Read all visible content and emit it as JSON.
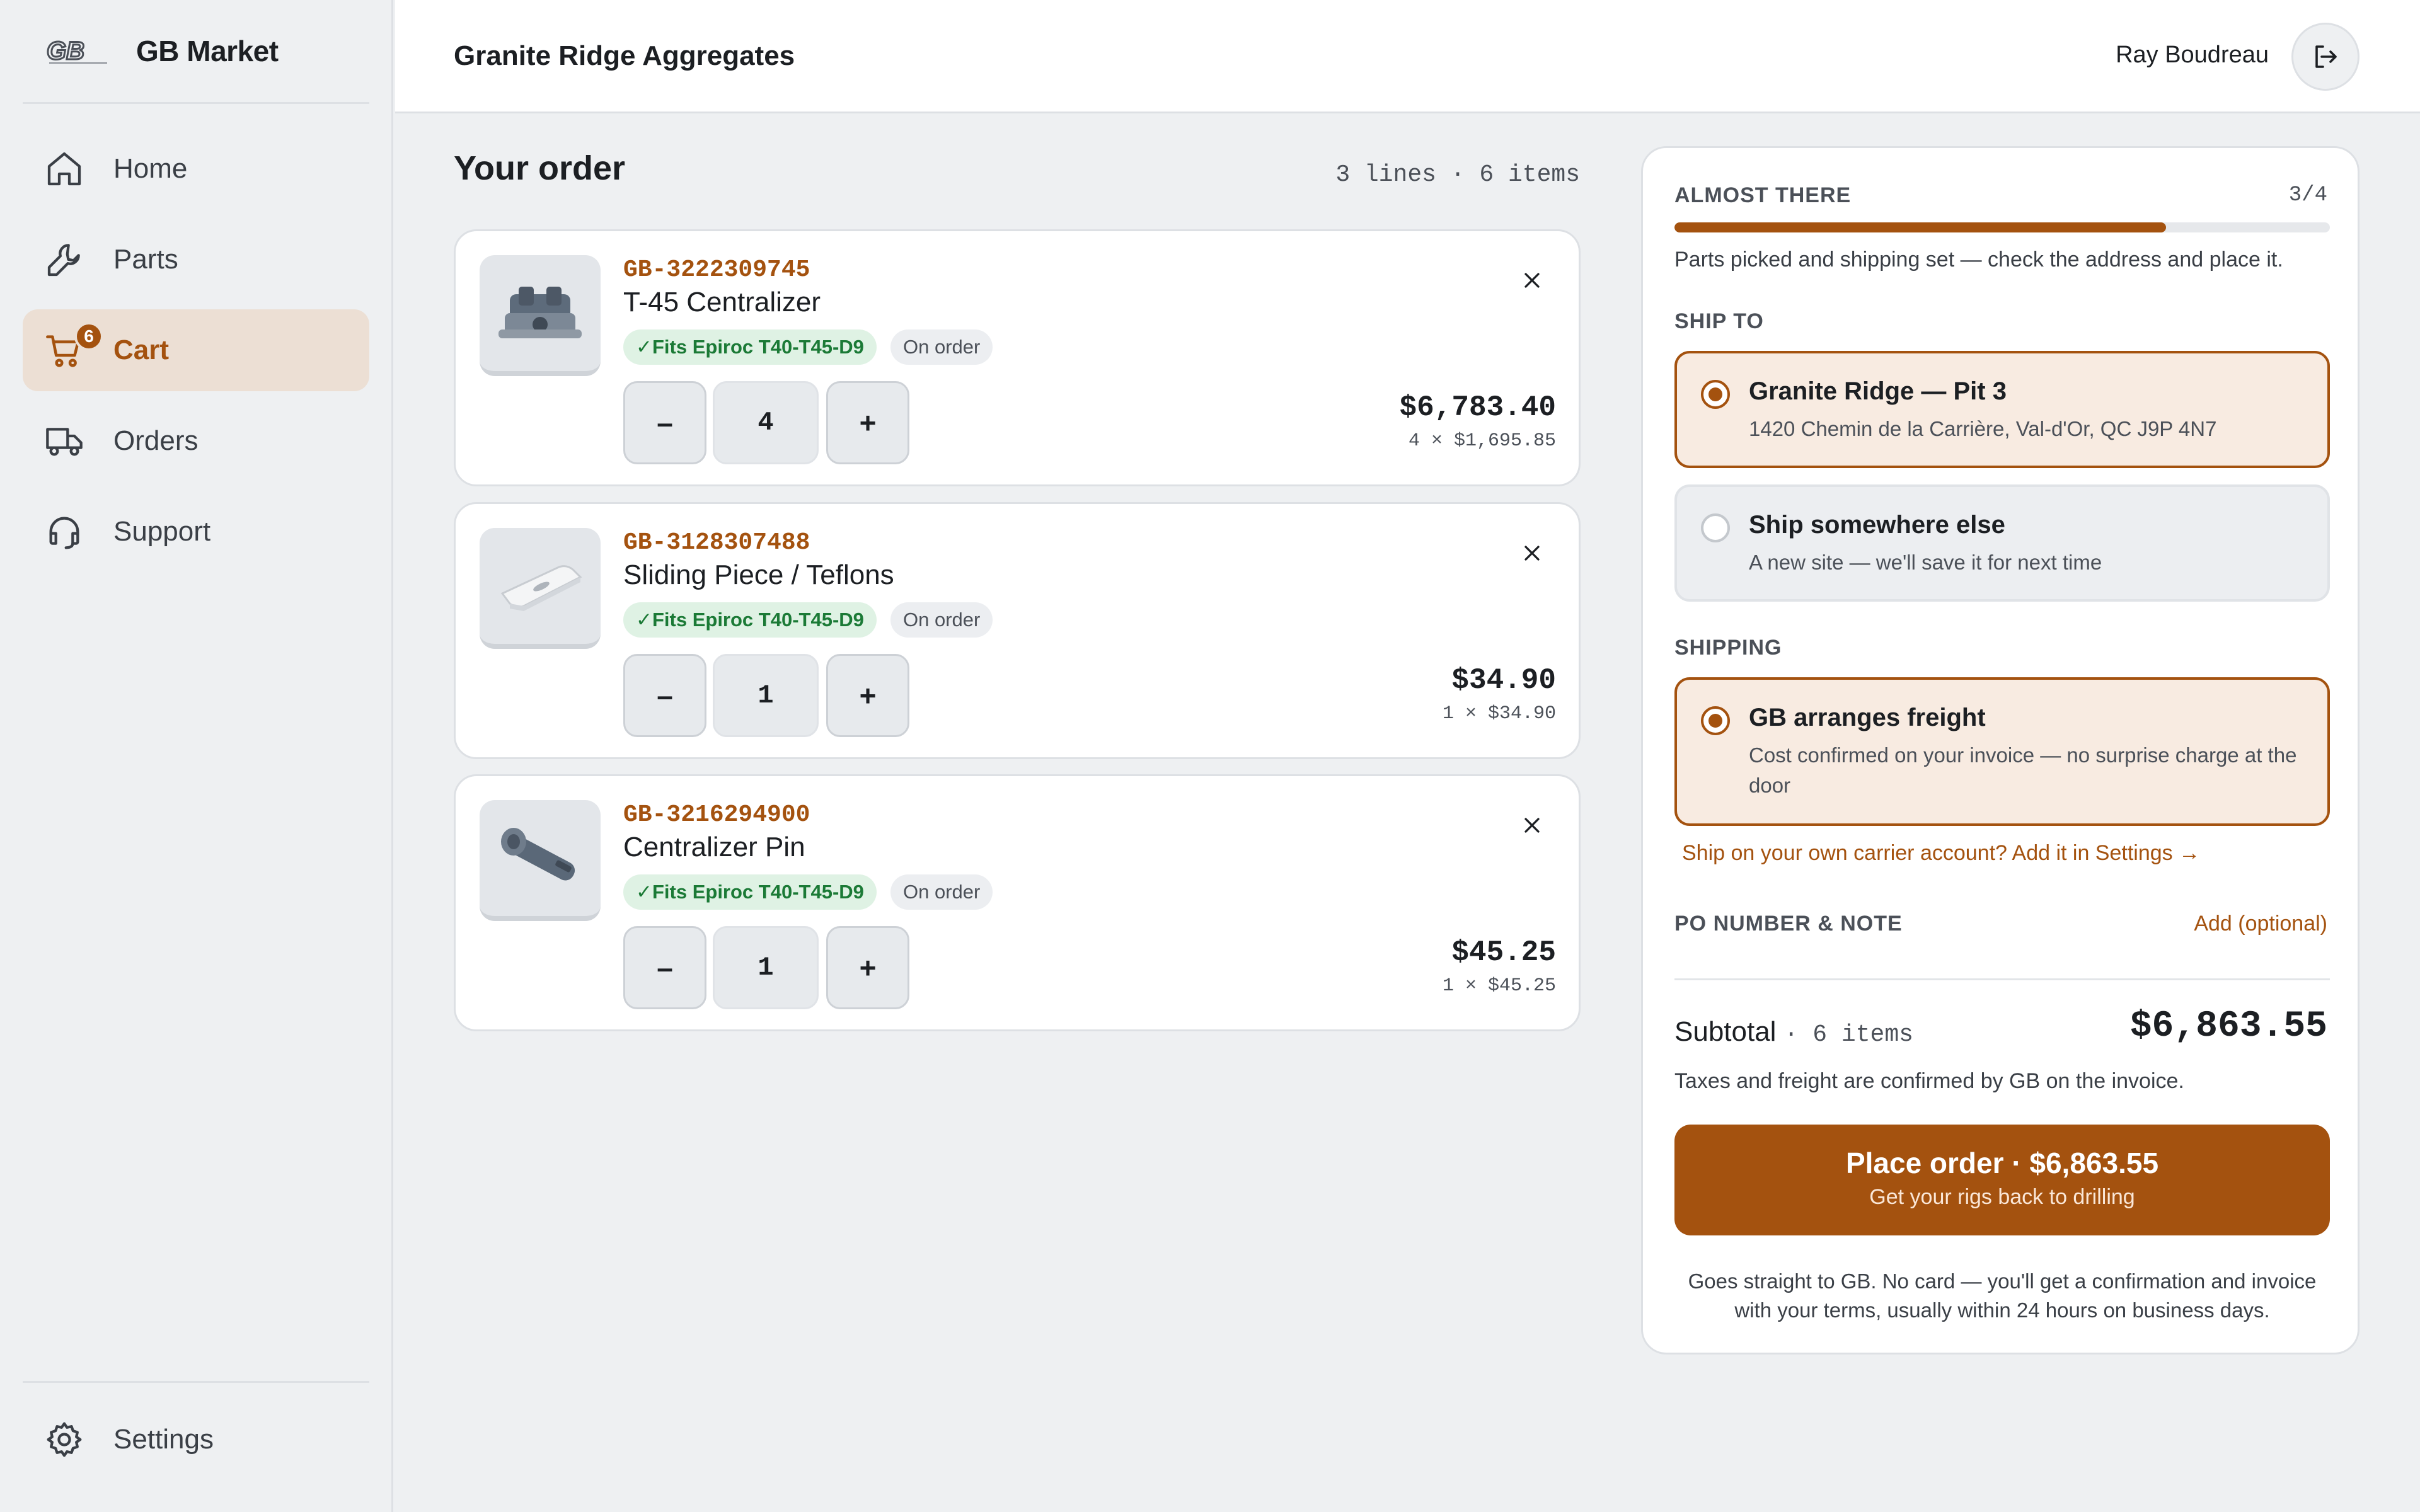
{
  "brand": {
    "name": "GB Market"
  },
  "sidebar": {
    "items": [
      {
        "label": "Home",
        "icon": "home-icon"
      },
      {
        "label": "Parts",
        "icon": "wrench-icon"
      },
      {
        "label": "Cart",
        "icon": "cart-icon",
        "badge": "6",
        "active": true
      },
      {
        "label": "Orders",
        "icon": "truck-icon"
      },
      {
        "label": "Support",
        "icon": "headset-icon"
      }
    ],
    "settings": {
      "label": "Settings",
      "icon": "gear-icon"
    }
  },
  "header": {
    "company": "Granite Ridge Aggregates",
    "user": "Ray Boudreau",
    "logout_icon": "logout-icon"
  },
  "order": {
    "title": "Your order",
    "summary": "3 lines · 6 items",
    "lines": [
      {
        "sku": "GB-3222309745",
        "name": "T-45 Centralizer",
        "fits": "✓Fits Epiroc T40-T45-D9",
        "status": "On order",
        "qty": "4",
        "total": "$6,783.40",
        "unit": "4 × $1,695.85"
      },
      {
        "sku": "GB-3128307488",
        "name": "Sliding Piece / Teflons",
        "fits": "✓Fits Epiroc T40-T45-D9",
        "status": "On order",
        "qty": "1",
        "total": "$34.90",
        "unit": "1 × $34.90"
      },
      {
        "sku": "GB-3216294900",
        "name": "Centralizer Pin",
        "fits": "✓Fits Epiroc T40-T45-D9",
        "status": "On order",
        "qty": "1",
        "total": "$45.25",
        "unit": "1 × $45.25"
      }
    ],
    "minus": "–",
    "plus": "+"
  },
  "checkout": {
    "progress_label": "ALMOST THERE",
    "progress_step": "3/4",
    "progress_fraction": 0.75,
    "progress_note": "Parts picked and shipping set — check the address and place it.",
    "ship_to_label": "SHIP TO",
    "ship_options": [
      {
        "title": "Granite Ridge — Pit 3",
        "sub": "1420 Chemin de la Carrière, Val-d'Or, QC J9P 4N7",
        "selected": true
      },
      {
        "title": "Ship somewhere else",
        "sub": "A new site — we'll save it for next time",
        "selected": false
      }
    ],
    "shipping_label": "SHIPPING",
    "shipping_option": {
      "title": "GB arranges freight",
      "sub": "Cost confirmed on your invoice — no surprise charge at the door",
      "selected": true
    },
    "carrier_link": "Ship on your own carrier account? Add it in Settings →",
    "po_label": "PO NUMBER & NOTE",
    "po_add": "Add (optional)",
    "subtotal_label": "Subtotal",
    "subtotal_items": "· 6 items",
    "subtotal_value": "$6,863.55",
    "tax_note": "Taxes and freight are confirmed by GB on the invoice.",
    "place_button": "Place order · $6,863.55",
    "place_sub": "Get your rigs back to drilling",
    "foot_note": "Goes straight to GB. No card — you'll get a confirmation and invoice with your terms, usually within 24 hours on business days."
  },
  "colors": {
    "accent": "#a4520f",
    "accent_soft": "#f8ebe1",
    "fits_green": "#1b7a36"
  }
}
